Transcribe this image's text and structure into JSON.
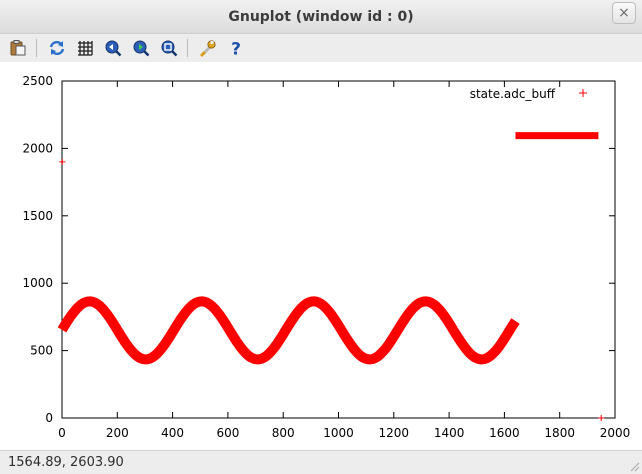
{
  "window": {
    "title": "Gnuplot (window id : 0)",
    "close_glyph": "×"
  },
  "toolbar": {
    "items": [
      {
        "name": "copy-clipboard-icon",
        "tooltip": ""
      },
      {
        "name": "replot-icon",
        "tooltip": ""
      },
      {
        "name": "grid-icon",
        "tooltip": ""
      },
      {
        "name": "zoom-previous-icon",
        "tooltip": ""
      },
      {
        "name": "zoom-next-icon",
        "tooltip": ""
      },
      {
        "name": "autoscale-icon",
        "tooltip": ""
      },
      {
        "name": "options-wrench-icon",
        "tooltip": ""
      },
      {
        "name": "help-icon",
        "tooltip": ""
      }
    ]
  },
  "status": {
    "coords": "1564.89,  2603.90"
  },
  "colors": {
    "series": "#ff0000",
    "toolbar_bg": "#ededed"
  },
  "chart_data": {
    "type": "scatter",
    "title": "",
    "xlabel": "",
    "ylabel": "",
    "xlim": [
      0,
      2000
    ],
    "ylim": [
      0,
      2500
    ],
    "xticks": [
      "0",
      "200",
      "400",
      "600",
      "800",
      "1000",
      "1200",
      "1400",
      "1600",
      "1800",
      "2000"
    ],
    "yticks": [
      "0",
      "500",
      "1000",
      "1500",
      "2000",
      "2500"
    ],
    "grid": false,
    "legend_position": "top-right",
    "series": [
      {
        "name": "state.adc_buff",
        "color": "#ff0000",
        "marker": "+",
        "segments": [
          {
            "kind": "sine",
            "x_start": 0,
            "x_end": 1640,
            "center": 650,
            "amplitude": 215,
            "period": 405,
            "first_peak_x": 100
          },
          {
            "kind": "flat",
            "x_start": 1640,
            "x_end": 1940,
            "y": 2095
          }
        ],
        "isolated_points": [
          {
            "x": 1,
            "y": 1900
          },
          {
            "x": 1950,
            "y": 0
          }
        ]
      }
    ]
  }
}
